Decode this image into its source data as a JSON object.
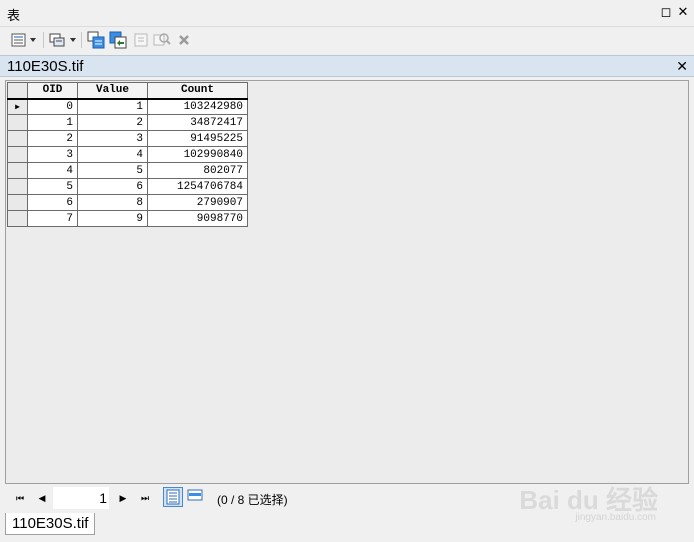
{
  "window": {
    "title": "表",
    "restore_symbol": "◻",
    "close_symbol": "✕"
  },
  "toolbar": {
    "buttons": [
      {
        "icon": "table-options-icon"
      },
      {
        "icon": "related-tables-icon"
      },
      {
        "icon": "select-by-attributes-icon"
      },
      {
        "icon": "switch-selection-icon"
      },
      {
        "icon": "clear-selection-icon"
      },
      {
        "icon": "zoom-to-selected-icon"
      },
      {
        "icon": "delete-selected-icon"
      }
    ]
  },
  "tab": {
    "title": "110E30S.tif",
    "close_symbol": "✕"
  },
  "table": {
    "columns": [
      "OID",
      "Value",
      "Count"
    ],
    "rows": [
      [
        "0",
        "1",
        "103242980"
      ],
      [
        "1",
        "2",
        "34872417"
      ],
      [
        "2",
        "3",
        "91495225"
      ],
      [
        "3",
        "4",
        "102990840"
      ],
      [
        "4",
        "5",
        "802077"
      ],
      [
        "5",
        "6",
        "1254706784"
      ],
      [
        "6",
        "8",
        "2790907"
      ],
      [
        "7",
        "9",
        "9098770"
      ]
    ],
    "current_row_marker": "▶"
  },
  "navigation": {
    "first": "⏮",
    "previous": "◀",
    "record": "1",
    "next": "▶",
    "last": "⏭",
    "selection_status": "(0 / 8 已选择)"
  },
  "bottom_tab": {
    "label": "110E30S.tif"
  },
  "watermark": {
    "text": "Bai du 经验",
    "subtext": "jingyan.baidu.com"
  }
}
